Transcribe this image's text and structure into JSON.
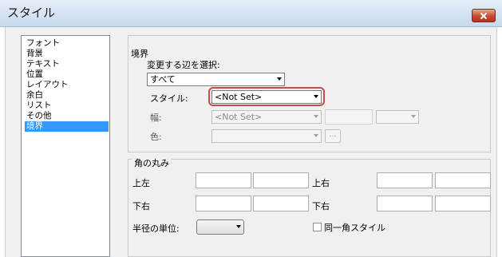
{
  "window": {
    "title": "スタイル"
  },
  "categories": [
    "フォント",
    "背景",
    "テキスト",
    "位置",
    "レイアウト",
    "余白",
    "リスト",
    "その他",
    "境界"
  ],
  "selected_category": "境界",
  "border": {
    "group_title": "境界",
    "select_sides_label": "変更する辺を選択:",
    "sides_value": "すべて",
    "style_label": "スタイル:",
    "style_value": "<Not Set>",
    "width_label": "幅:",
    "width_value": "<Not Set>",
    "color_label": "色:",
    "color_button": "..."
  },
  "corners": {
    "group_title": "角の丸み",
    "top_left": "上左",
    "top_right": "上右",
    "bottom_right_1": "下右",
    "bottom_right_2": "下右",
    "radius_unit_label": "半径の単位:",
    "same_corner_label": "同一角スタイル"
  }
}
